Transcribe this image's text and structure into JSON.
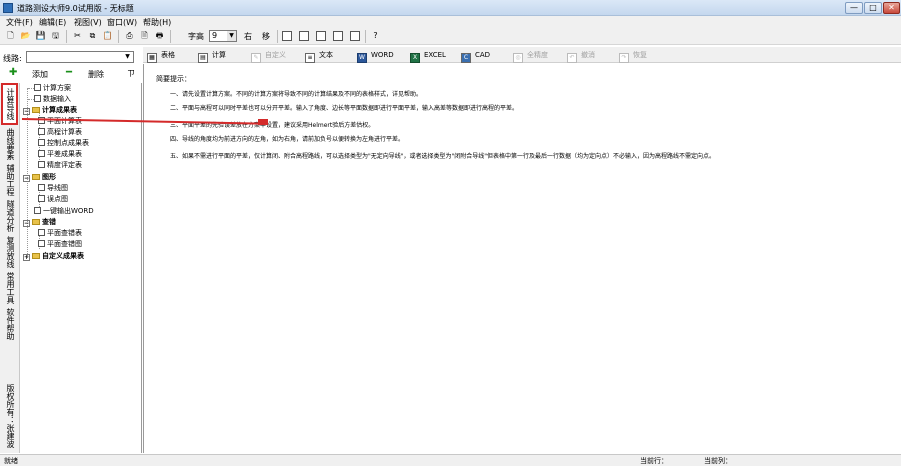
{
  "window": {
    "title": "道路测设大师9.0试用版 - 无标题",
    "min": "—",
    "max": "□",
    "close": "✕"
  },
  "menu": [
    "文件(F)",
    "编辑(E)",
    "视图(V)",
    "窗口(W)",
    "帮助(H)"
  ],
  "toolbar": {
    "font_label": "字高",
    "font_value": "9",
    "align_right": "右",
    "move": "移"
  },
  "left_panel": {
    "route_label": "线路:",
    "route_value": "",
    "add": "添加",
    "delete": "删除",
    "pin": "ㄗ"
  },
  "vtabs": [
    "计算导线",
    "曲线要素",
    "辅助工程",
    "隧道分析",
    "复测放线",
    "常用工具",
    "软件帮助",
    "版权所有：张建波"
  ],
  "tree": {
    "calc_scheme": "计算方案",
    "data_input": "数据输入",
    "calc_results": "计算成果表",
    "plane_calc": "平面计算表",
    "elev_calc": "高程计算表",
    "control_points": "控制点成果表",
    "plane_results": "平差成果表",
    "accuracy": "精度评定表",
    "graphics": "图形",
    "traverse_map": "导线图",
    "error_ellipse": "误点图",
    "export_word": "一键输出WORD",
    "check": "查错",
    "plane_check_table": "平面查错表",
    "plane_check_map": "平面查错图",
    "custom_results": "自定义成果表"
  },
  "right_toolbar": {
    "table": "表格",
    "calc": "计算",
    "customize": "自定义",
    "text": "文本",
    "word": "WORD",
    "excel": "EXCEL",
    "cad": "CAD",
    "full_precision": "全精度",
    "undo": "撤消",
    "redo": "恢复"
  },
  "content": {
    "heading": "简要提示：",
    "lines": [
      "一、请先设置计算方案。不同的计算方案将导致不同的计算结果及不同的表格样式，详见帮助。",
      "二、平面与高程可以同时平差也可以分开平差。输入了角度、边长等平面数据即进行平面平差，输入高差等数据即进行高程的平差。",
      "三、平面平差的先验误差放在方案中设置，建议采用Helmert验后方差估权。",
      "四、导线的角度均为前进方向的左角，如为右角，请前加负号以便转换为左角进行平差。",
      "五、如果不需进行平面的平差，仅计算闭、附合高程路线，可以选择类型为\"无定向导线\"，或者选择类型为\"闭附合导线\"但表格中第一行及最后一行数据（均为定向点）不必输入，因为高程路线不需定向点。"
    ]
  },
  "status": {
    "left": "就绪",
    "row_label": "当前行：",
    "col_label": "当前列："
  },
  "colors": {
    "highlight": "#d42a2a",
    "title_gradient_top": "#dbe8f7"
  }
}
